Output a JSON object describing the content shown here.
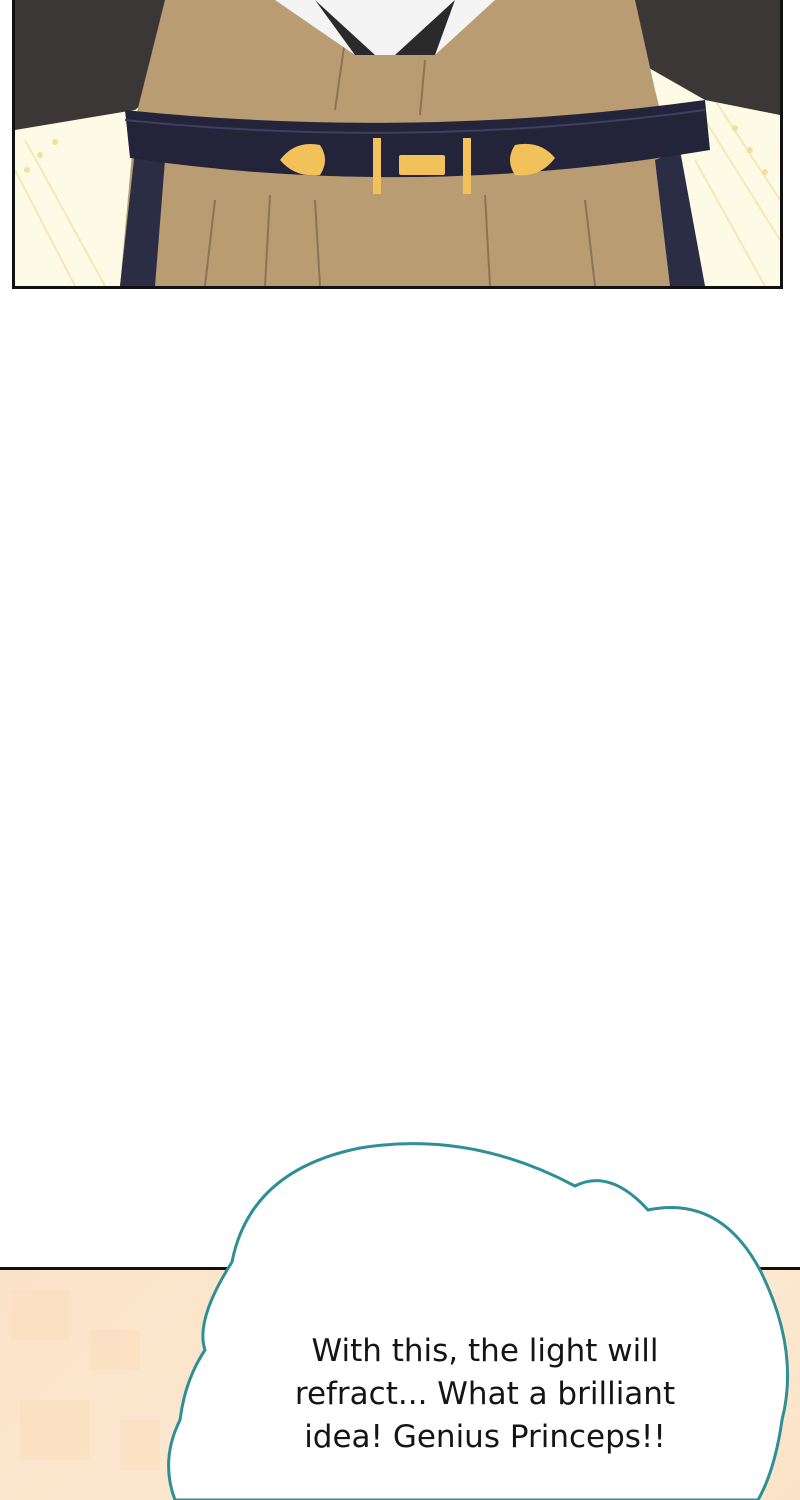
{
  "dialogue": {
    "speech_bubble_text": "With this, the light will\nrefract... What a brilliant\nidea! Genius Princeps!!"
  },
  "colors": {
    "bubble_outline": "#2f8f96",
    "bubble_fill": "#ffffff",
    "panel_border": "#111111",
    "belt": "#23243a",
    "belt_gold": "#f2c15a",
    "robe": "#b89b72",
    "robe_dark": "#3a3536",
    "lower_panel_bg": "#fbe5cc"
  }
}
